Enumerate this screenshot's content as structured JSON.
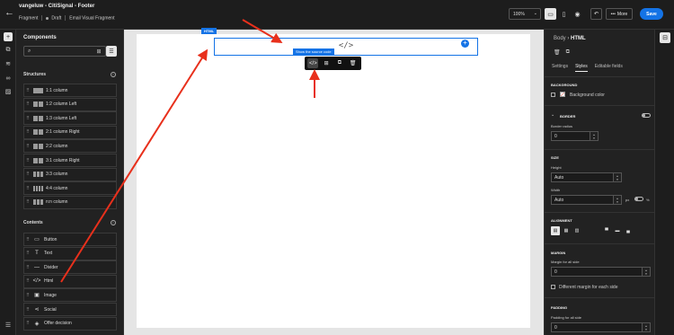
{
  "header": {
    "back_glyph": "←",
    "title": "vangeluw - CitiSignal - Footer",
    "type": "Fragment",
    "status": "Draft",
    "kind": "Email Visual Fragment",
    "zoom": "100%",
    "more_label": "More",
    "save_label": "Save"
  },
  "left_rail": {
    "icons": [
      "add-icon",
      "fragments-icon",
      "layers-icon",
      "link-icon",
      "assets-icon",
      "help-icon"
    ]
  },
  "components_panel": {
    "title": "Components",
    "search_placeholder": "",
    "structures_label": "Structures",
    "structures": [
      {
        "label": "1:1 column",
        "cols": 1
      },
      {
        "label": "1:2 column Left",
        "cols": 2
      },
      {
        "label": "1:3 column Left",
        "cols": 2
      },
      {
        "label": "2:1 column Right",
        "cols": 2
      },
      {
        "label": "2:2 column",
        "cols": 2
      },
      {
        "label": "3:1 column Right",
        "cols": 2
      },
      {
        "label": "3:3 column",
        "cols": 3
      },
      {
        "label": "4:4 column",
        "cols": 4
      },
      {
        "label": "n:n column",
        "cols": 3
      }
    ],
    "contents_label": "Contents",
    "contents": [
      {
        "label": "Button",
        "icon": "button-icon",
        "glyph": "▭"
      },
      {
        "label": "Text",
        "icon": "text-icon",
        "glyph": "T"
      },
      {
        "label": "Divider",
        "icon": "divider-icon",
        "glyph": "—"
      },
      {
        "label": "Html",
        "icon": "html-code-icon",
        "glyph": "</>"
      },
      {
        "label": "Image",
        "icon": "image-icon",
        "glyph": "▣"
      },
      {
        "label": "Social",
        "icon": "share-icon",
        "glyph": "⋖"
      },
      {
        "label": "Offer decision",
        "icon": "offer-icon",
        "glyph": "◈"
      }
    ]
  },
  "canvas": {
    "html_tag": "HTML",
    "code_glyph": "</>",
    "tooltip": "Show the source code",
    "toolbar_icons": [
      "code-icon",
      "select-parent-icon",
      "duplicate-icon",
      "delete-icon"
    ]
  },
  "properties": {
    "breadcrumb_parent": "Body",
    "breadcrumb_current": "HTML",
    "tabs": [
      "Settings",
      "Styles",
      "Editable fields"
    ],
    "active_tab": "Styles",
    "background_section": "BACKGROUND",
    "background_color_label": "Background color",
    "border_section": "BORDER",
    "border_radius_label": "Border radius",
    "border_radius_value": "0",
    "size_section": "SIZE",
    "height_label": "Height",
    "height_value": "Auto",
    "width_label": "Width",
    "width_value": "Auto",
    "width_unit_px": "px",
    "width_unit_pct": "%",
    "alignment_section": "ALIGNMENT",
    "margin_section": "MARGIN",
    "margin_all_label": "Margin for all side",
    "margin_all_value": "0",
    "margin_each_label": "Different margin for each side",
    "padding_section": "PADDING",
    "padding_all_label": "Padding for all side",
    "padding_all_value": "0"
  },
  "colors": {
    "accent": "#1473e6",
    "annotation_arrow": "#e8301c",
    "background_swatch": "#e8301c"
  }
}
